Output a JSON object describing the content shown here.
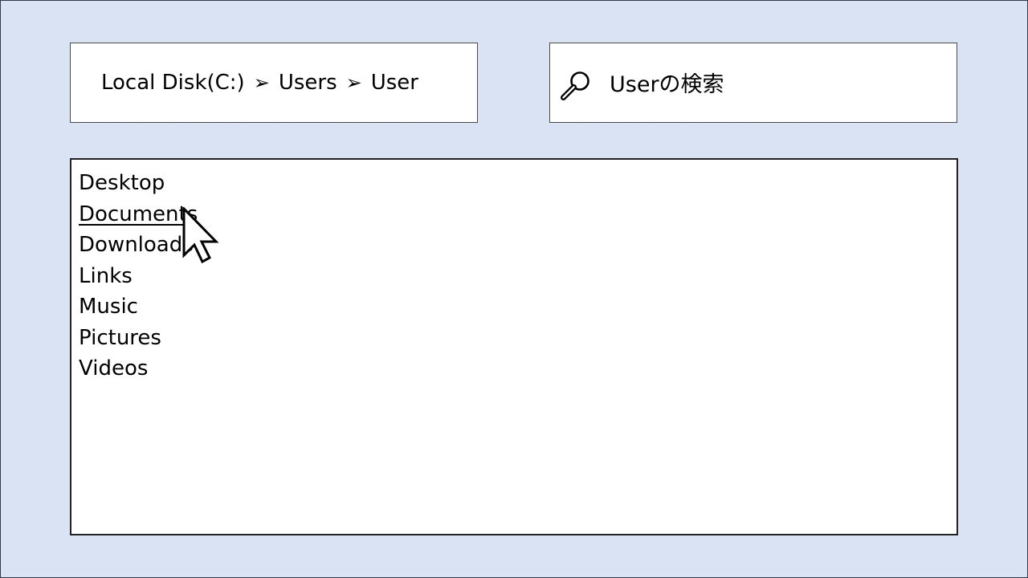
{
  "breadcrumb": {
    "items": [
      "Local Disk(C:)",
      "Users",
      "User"
    ],
    "separator": "➢"
  },
  "search": {
    "icon": "search-icon",
    "placeholder": "Userの検索"
  },
  "file_list": {
    "items": [
      {
        "label": "Desktop",
        "underlined": false
      },
      {
        "label": "Documents",
        "underlined": true
      },
      {
        "label": "Downloads",
        "underlined": false
      },
      {
        "label": "Links",
        "underlined": false
      },
      {
        "label": "Music",
        "underlined": false
      },
      {
        "label": "Pictures",
        "underlined": false
      },
      {
        "label": "Videos",
        "underlined": false
      }
    ]
  },
  "colors": {
    "background": "#dae3f3",
    "panel": "#ffffff",
    "border": "#222222"
  },
  "cursor": {
    "icon": "mouse-pointer-icon",
    "hovering": "Documents"
  }
}
